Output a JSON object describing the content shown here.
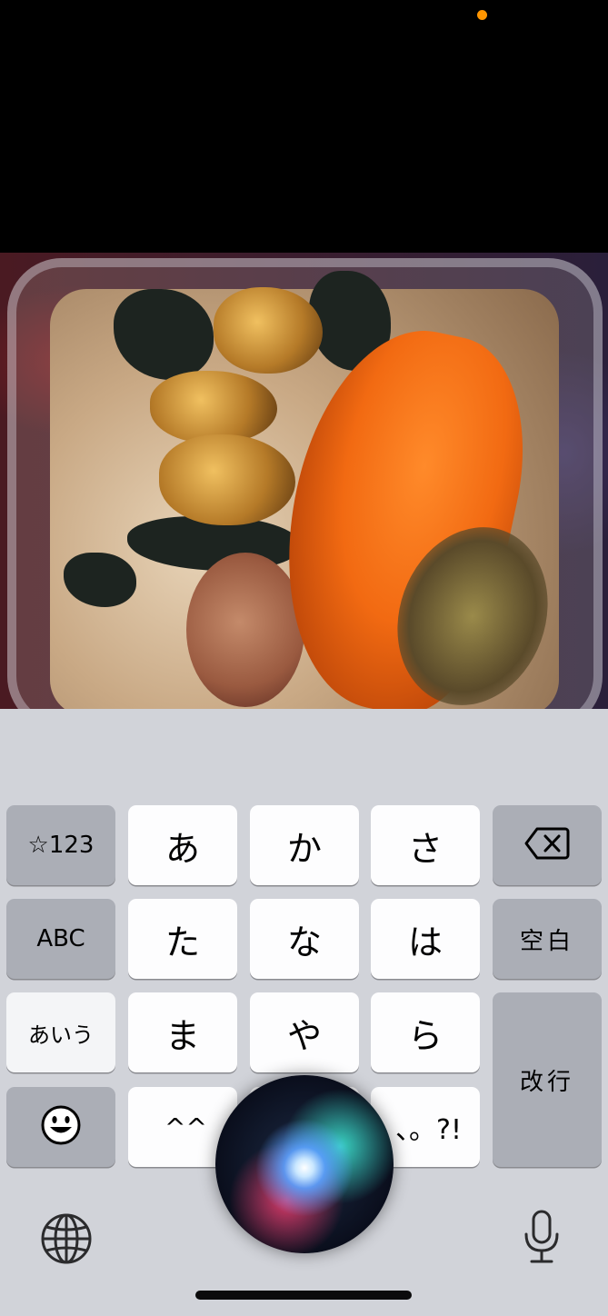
{
  "keyboard": {
    "row1": {
      "symbols": "☆123",
      "a": "あ",
      "ka": "か",
      "sa": "さ"
    },
    "row2": {
      "abc": "ABC",
      "ta": "た",
      "na": "な",
      "ha": "は",
      "space": "空白"
    },
    "row3": {
      "aiu": "あいう",
      "ma": "ま",
      "ya": "や",
      "ra": "ら",
      "return": "改行"
    },
    "row4": {
      "wa": "^^",
      "punct": "、。?!"
    }
  },
  "icons": {
    "delete": "delete-backspace-icon",
    "emoji": "smiley-face-icon",
    "globe": "globe-icon",
    "mic": "microphone-icon",
    "siri": "siri-orb-icon"
  },
  "colors": {
    "keyboard_bg": "#d1d3d9",
    "light_key": "#fdfdfe",
    "dark_key": "#abaeb6",
    "privacy_dot": "#ff9500"
  }
}
